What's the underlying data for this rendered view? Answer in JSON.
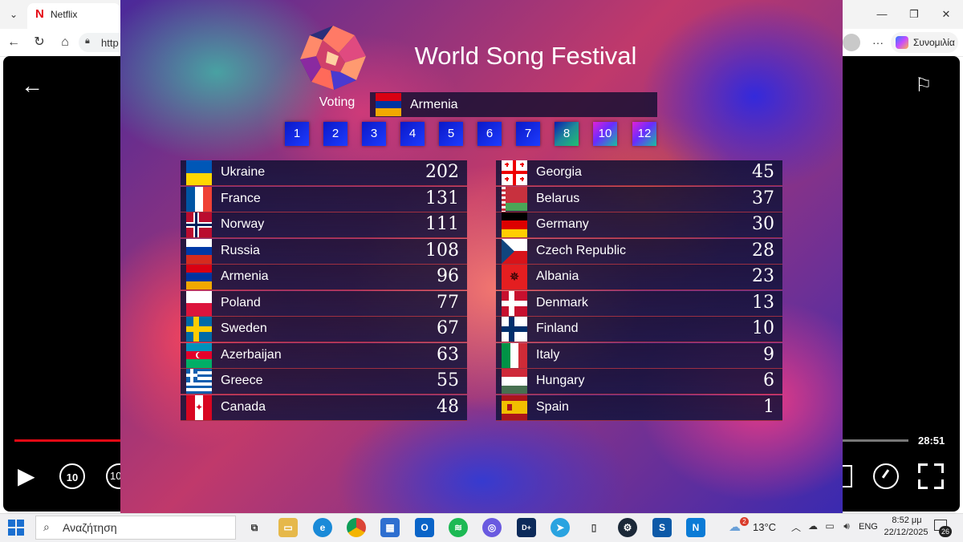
{
  "browser": {
    "tab_title": "Netflix",
    "tab_logo": "N",
    "url_partial": "http",
    "copilot_label": "Συνομιλία",
    "window_controls": [
      "minimize-icon",
      "restore-icon",
      "close-icon"
    ]
  },
  "player": {
    "time_remaining": "28:51",
    "rewind_label": "10",
    "forward_label": "10",
    "progress": 0.12
  },
  "scoreboard": {
    "title": "World Song Festival",
    "voting_label": "Voting",
    "current_voter": "Armenia",
    "points": [
      "1",
      "2",
      "3",
      "4",
      "5",
      "6",
      "7",
      "8",
      "10",
      "12"
    ],
    "left_column": [
      {
        "country": "Ukraine",
        "score": "202",
        "flag": "ukraine"
      },
      {
        "country": "France",
        "score": "131",
        "flag": "france"
      },
      {
        "country": "Norway",
        "score": "111",
        "flag": "norway"
      },
      {
        "country": "Russia",
        "score": "108",
        "flag": "russia"
      },
      {
        "country": "Armenia",
        "score": "96",
        "flag": "armenia"
      },
      {
        "country": "Poland",
        "score": "77",
        "flag": "poland"
      },
      {
        "country": "Sweden",
        "score": "67",
        "flag": "sweden"
      },
      {
        "country": "Azerbaijan",
        "score": "63",
        "flag": "azerbaijan"
      },
      {
        "country": "Greece",
        "score": "55",
        "flag": "greece"
      },
      {
        "country": "Canada",
        "score": "48",
        "flag": "canada"
      }
    ],
    "right_column": [
      {
        "country": "Georgia",
        "score": "45",
        "flag": "georgia"
      },
      {
        "country": "Belarus",
        "score": "37",
        "flag": "belarus"
      },
      {
        "country": "Germany",
        "score": "30",
        "flag": "germany"
      },
      {
        "country": "Czech Republic",
        "score": "28",
        "flag": "czech"
      },
      {
        "country": "Albania",
        "score": "23",
        "flag": "albania"
      },
      {
        "country": "Denmark",
        "score": "13",
        "flag": "denmark"
      },
      {
        "country": "Finland",
        "score": "10",
        "flag": "finland"
      },
      {
        "country": "Italy",
        "score": "9",
        "flag": "italy"
      },
      {
        "country": "Hungary",
        "score": "6",
        "flag": "hungary"
      },
      {
        "country": "Spain",
        "score": "1",
        "flag": "spain"
      }
    ]
  },
  "taskbar": {
    "search_placeholder": "Αναζήτηση",
    "weather_temp": "13°C",
    "weather_badge": "2",
    "language": "ENG",
    "time": "8:52 μμ",
    "date": "22/12/2025",
    "notification_count": "26",
    "apps": [
      "task-view",
      "file-explorer",
      "edge",
      "chrome",
      "microsoft-store",
      "outlook",
      "spotify",
      "game-app",
      "disney-plus",
      "telegram",
      "mouse-app",
      "steam",
      "sourcetree",
      "netflix-app"
    ]
  },
  "colors": {
    "netflix_red": "#e50914",
    "point_blue": "#1d3cff",
    "row_bg": "#0c0e30"
  }
}
